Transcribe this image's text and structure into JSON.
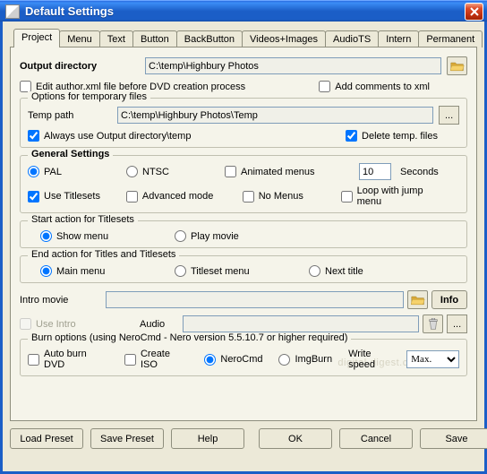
{
  "window": {
    "title": "Default Settings"
  },
  "tabs": [
    "Project",
    "Menu",
    "Text",
    "Button",
    "BackButton",
    "Videos+Images",
    "AudioTS",
    "Intern",
    "Permanent"
  ],
  "active_tab_index": 0,
  "output": {
    "label": "Output directory",
    "value": "C:\\temp\\Highbury Photos",
    "edit_author_label": "Edit author.xml file before DVD creation process",
    "edit_author_checked": false,
    "add_comments_label": "Add comments to xml",
    "add_comments_checked": false
  },
  "tempfiles": {
    "legend": "Options for temporary files",
    "temp_path_label": "Temp path",
    "temp_path_value": "C:\\temp\\Highbury Photos\\Temp",
    "always_label": "Always use Output directory\\temp",
    "always_checked": true,
    "delete_label": "Delete temp. files",
    "delete_checked": true
  },
  "general": {
    "legend": "General Settings",
    "pal_label": "PAL",
    "pal_checked": true,
    "ntsc_label": "NTSC",
    "ntsc_checked": false,
    "animated_label": "Animated menus",
    "animated_checked": false,
    "seconds_value": "10",
    "seconds_label": "Seconds",
    "titlesets_label": "Use Titlesets",
    "titlesets_checked": true,
    "advanced_label": "Advanced mode",
    "advanced_checked": false,
    "nomenus_label": "No Menus",
    "nomenus_checked": false,
    "loopjump_label": "Loop with jump menu",
    "loopjump_checked": false
  },
  "startaction": {
    "legend": "Start action for Titlesets",
    "showmenu_label": "Show menu",
    "showmenu_checked": true,
    "playmovie_label": "Play movie",
    "playmovie_checked": false
  },
  "endaction": {
    "legend": "End action for Titles and Titlesets",
    "mainmenu_label": "Main menu",
    "mainmenu_checked": true,
    "titleset_label": "Titleset menu",
    "titleset_checked": false,
    "nexttitle_label": "Next title",
    "nexttitle_checked": false
  },
  "intro": {
    "label": "Intro movie",
    "value": "",
    "info_btn": "Info",
    "useintro_label": "Use Intro",
    "useintro_checked": false,
    "useintro_enabled": false,
    "audio_label": "Audio",
    "audio_value": ""
  },
  "burn": {
    "legend": "Burn options (using NeroCmd - Nero version 5.5.10.7 or higher required)",
    "autoburn_label": "Auto burn DVD",
    "autoburn_checked": false,
    "createiso_label": "Create ISO",
    "createiso_checked": false,
    "nerocmd_label": "NeroCmd",
    "nerocmd_checked": true,
    "imgburn_label": "ImgBurn",
    "imgburn_checked": false,
    "writespeed_label": "Write speed",
    "writespeed_value": "Max."
  },
  "buttons": {
    "load_preset": "Load Preset",
    "save_preset": "Save Preset",
    "help": "Help",
    "ok": "OK",
    "cancel": "Cancel",
    "save": "Save"
  },
  "watermark": "digital-digest.com"
}
